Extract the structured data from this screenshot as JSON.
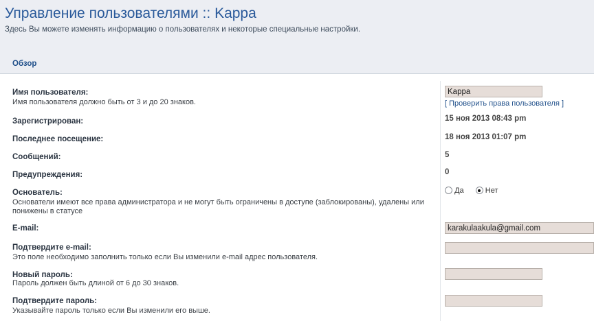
{
  "header": {
    "title": "Управление пользователями :: Kappa",
    "description": "Здесь Вы можете изменять информацию о пользователях и некоторые специальные настройки."
  },
  "tabs": [
    {
      "label": "Обзор",
      "active": true
    }
  ],
  "fields": {
    "username": {
      "label": "Имя пользователя:",
      "explain": "Имя пользователя должно быть от 3 и до 20 знаков.",
      "value": "Kappa",
      "link_text": "Проверить права пользователя",
      "bracket_open": "[",
      "bracket_close": "]"
    },
    "registered": {
      "label": "Зарегистрирован:",
      "value": "15 ноя 2013 08:43 pm"
    },
    "last_visit": {
      "label": "Последнее посещение:",
      "value": "18 ноя 2013 01:07 pm"
    },
    "posts": {
      "label": "Сообщений:",
      "value": "5"
    },
    "warnings": {
      "label": "Предупреждения:",
      "value": "0"
    },
    "founder": {
      "label": "Основатель:",
      "explain": "Основатели имеют все права администратора и не могут быть ограничены в доступе (заблокированы), удалены или понижены в статусе",
      "options": [
        "Да",
        "Нет"
      ],
      "selected": "Нет"
    },
    "email": {
      "label": "E-mail:",
      "value": "karakulaakula@gmail.com"
    },
    "email_confirm": {
      "label": "Подтвердите e-mail:",
      "explain": "Это поле необходимо заполнить только если Вы изменили e-mail адрес пользователя.",
      "value": ""
    },
    "new_password": {
      "label": "Новый пароль:",
      "explain": "Пароль должен быть длиной от 6 до 30 знаков.",
      "value": ""
    },
    "password_confirm": {
      "label": "Подтвердите пароль:",
      "explain": "Указывайте пароль только если Вы изменили его выше.",
      "value": ""
    }
  },
  "colors": {
    "title": "#29599a",
    "input_bg": "#e6ddd8",
    "panel_bg": "#ffffff",
    "page_bg": "#eceef3"
  }
}
